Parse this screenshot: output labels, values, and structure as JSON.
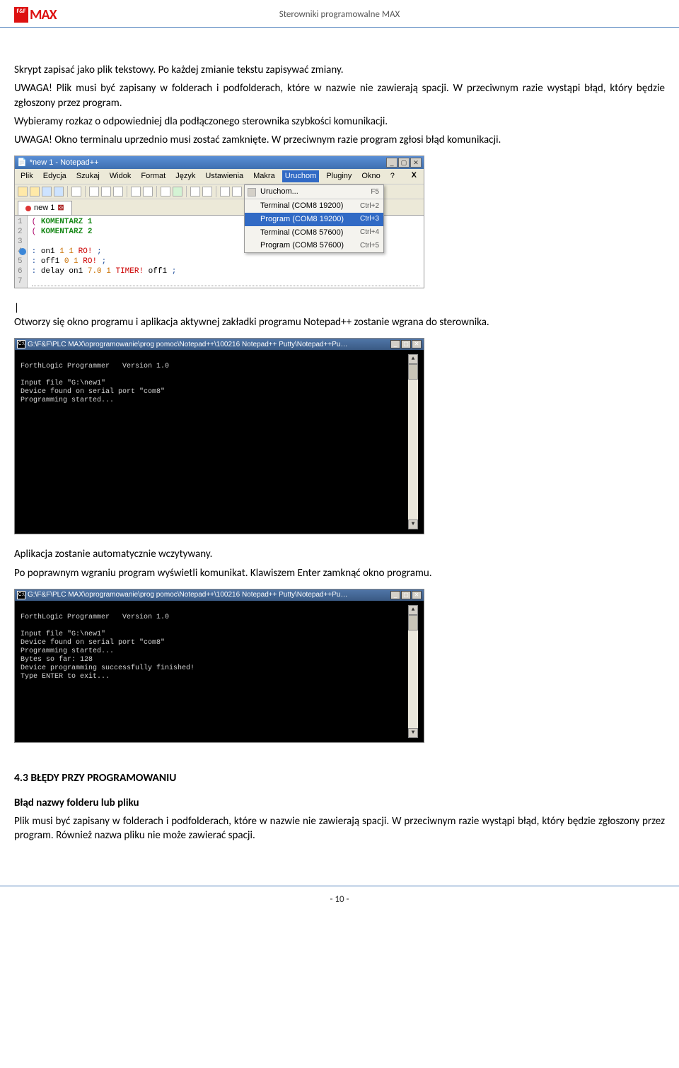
{
  "header": {
    "logo_small": "F&F",
    "logo_text": "MAX",
    "title": "Sterowniki programowalne MAX"
  },
  "body": {
    "p1": "Skrypt zapisać jako plik tekstowy. Po każdej zmianie tekstu zapisywać zmiany.",
    "p2": "UWAGA! Plik musi być zapisany w folderach i podfolderach, które w nazwie nie zawierają spacji. W przeciwnym razie wystąpi błąd, który będzie zgłoszony przez program.",
    "p3": "Wybieramy rozkaz o odpowiedniej dla podłączonego sterownika szybkości komunikacji.",
    "p4": "UWAGA! Okno terminalu uprzednio musi zostać zamknięte. W przeciwnym razie program zgłosi błąd komunikacji.",
    "p5": "Otworzy się okno programu i aplikacja aktywnej zakładki programu Notepad++ zostanie wgrana do sterownika.",
    "p6": "Aplikacja zostanie automatycznie wczytywany.",
    "p7": "Po poprawnym wgraniu program wyświetli komunikat. Klawiszem Enter zamknąć okno programu.",
    "section_title": "4.3  BŁĘDY PRZY PROGRAMOWANIU",
    "sub1_heading": "Błąd nazwy folderu lub pliku",
    "sub1_text": "Plik musi być zapisany w folderach i podfolderach, które w nazwie nie zawierają spacji. W przeciwnym razie wystąpi błąd, który będzie zgłoszony przez program. Również nazwa pliku nie może zawierać spacji."
  },
  "npp": {
    "title": "*new 1 - Notepad++",
    "menu": [
      "Plik",
      "Edycja",
      "Szukaj",
      "Widok",
      "Format",
      "Język",
      "Ustawienia",
      "Makra",
      "Uruchom",
      "Pluginy",
      "Okno",
      "?"
    ],
    "open_index": 8,
    "tab_label": "new 1",
    "run_menu": [
      {
        "label": "Uruchom...",
        "shortcut": "F5",
        "icon": true,
        "sep": false
      },
      {
        "label": "Terminal (COM8 19200)",
        "shortcut": "Ctrl+2",
        "icon": false,
        "sep": true
      },
      {
        "label": "Program (COM8 19200)",
        "shortcut": "Ctrl+3",
        "icon": false,
        "sep": false,
        "highlight": true
      },
      {
        "label": "Terminal (COM8 57600)",
        "shortcut": "Ctrl+4",
        "icon": false,
        "sep": false
      },
      {
        "label": "Program (COM8 57600)",
        "shortcut": "Ctrl+5",
        "icon": false,
        "sep": false
      }
    ],
    "lines": [
      "( KOMENTARZ 1",
      "( KOMENTARZ 2",
      "",
      ": on1 1 1 RO! ;",
      ": off1 0 1 RO! ;",
      ": delay on1 7.0 1 TIMER! off1 ;",
      ""
    ]
  },
  "console1": {
    "title": "G:\\F&F\\PLC MAX\\oprogramowanie\\prog pomoc\\Notepad++\\100216 Notepad++ Putty\\Notepad++Pu…",
    "text": "\nForthLogic Programmer   Version 1.0\n\nInput file \"G:\\new1\"\nDevice found on serial port \"com8\"\nProgramming started...\n"
  },
  "console2": {
    "title": "G:\\F&F\\PLC MAX\\oprogramowanie\\prog pomoc\\Notepad++\\100216 Notepad++ Putty\\Notepad++Pu…",
    "text": "\nForthLogic Programmer   Version 1.0\n\nInput file \"G:\\new1\"\nDevice found on serial port \"com8\"\nProgramming started...\nBytes so far: 128\nDevice programming successfully finished!\nType ENTER to exit...\n"
  },
  "footer": {
    "page_number": "- 10 -"
  }
}
